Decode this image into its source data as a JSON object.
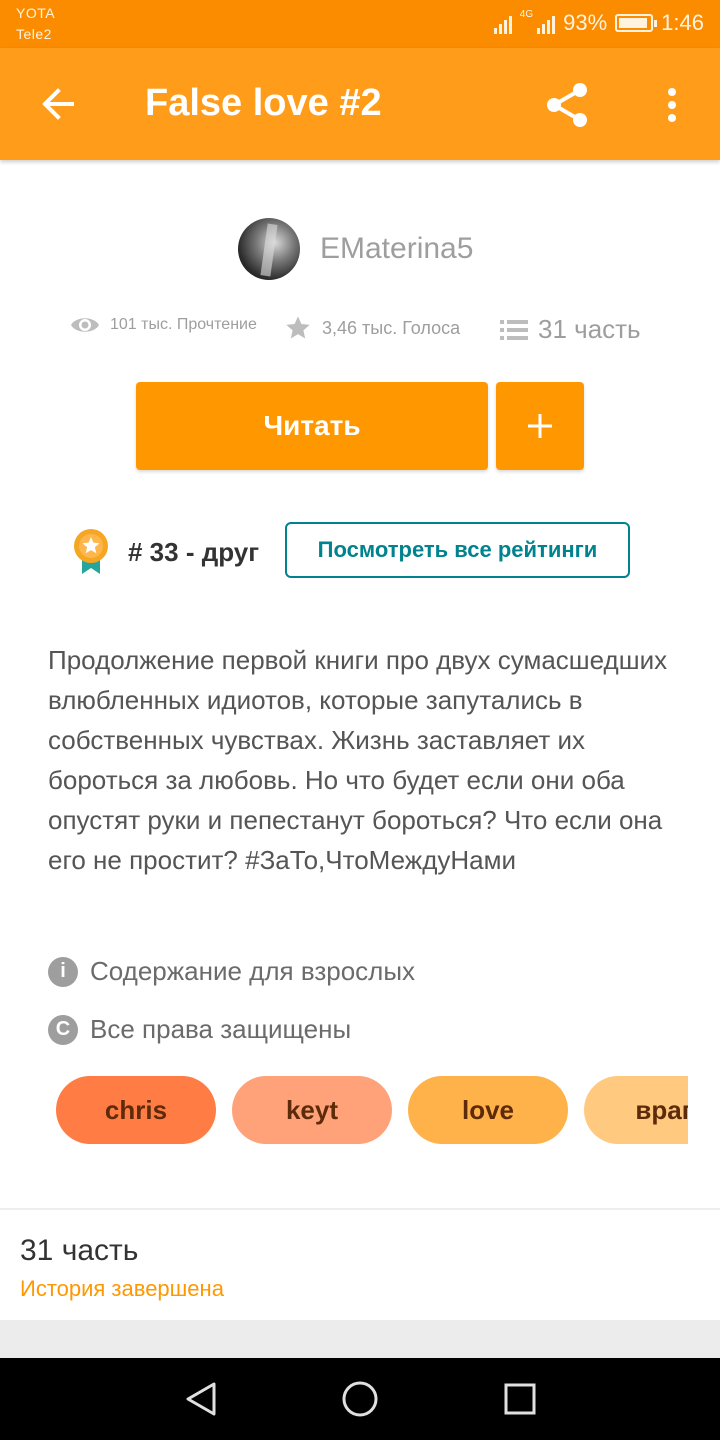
{
  "status_bar": {
    "carrier_1": "YOTA",
    "carrier_2": "Tele2",
    "network": "4G",
    "battery": "93%",
    "battery_level": 0.93,
    "time": "1:46"
  },
  "app_bar": {
    "title": "False love #2",
    "back_icon": "arrow-left-icon",
    "share_icon": "share-icon",
    "more_icon": "more-vert-icon"
  },
  "author": {
    "name": "EMaterina5"
  },
  "stats": {
    "reads": "101 тыс. Прочтение",
    "votes": "3,46 тыс. Голоса",
    "parts": "31 часть"
  },
  "actions": {
    "read_label": "Читать",
    "add_label": "+"
  },
  "ranking": {
    "rank_text": "# 33 - друг",
    "ratings_label": "Посмотреть все рейтинги"
  },
  "description": "Продолжение первой книги про двух сумасшедших влюбленных идиотов, которые запутались в собственных чувствах. Жизнь заставляет их бороться за любовь. Но что будет если они оба опустят руки и пепестанут бороться? Что если она его не простит? #ЗаТо,ЧтоМеждуНами",
  "info": {
    "mature": "Содержание для взрослых",
    "copyright": "Все права защищены"
  },
  "tags": [
    "chris",
    "keyt",
    "love",
    "враг"
  ],
  "parts_section": {
    "count": "31 часть",
    "status": "История завершена"
  },
  "colors": {
    "accent": "#ff9800",
    "status_bar": "#fb8c00",
    "app_bar": "#ff9c1a",
    "teal": "#00838f"
  }
}
